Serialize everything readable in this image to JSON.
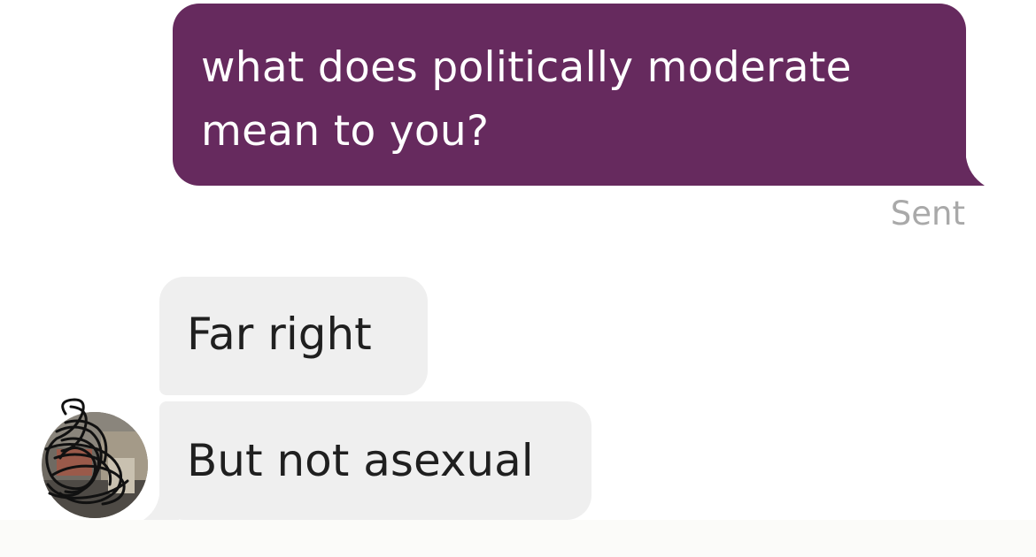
{
  "conversation": {
    "sent_message": "what does politically moderate mean to you?",
    "sent_status": "Sent",
    "received_messages": [
      {
        "text": "Far right"
      },
      {
        "text": "But not asexual"
      }
    ]
  },
  "colors": {
    "sent_bubble": "#662a5e",
    "received_bubble": "#efefef",
    "status_text": "#a9a9a9",
    "background": "#ffffff"
  },
  "icons": {
    "avatar": "scribbled-avatar-icon"
  }
}
